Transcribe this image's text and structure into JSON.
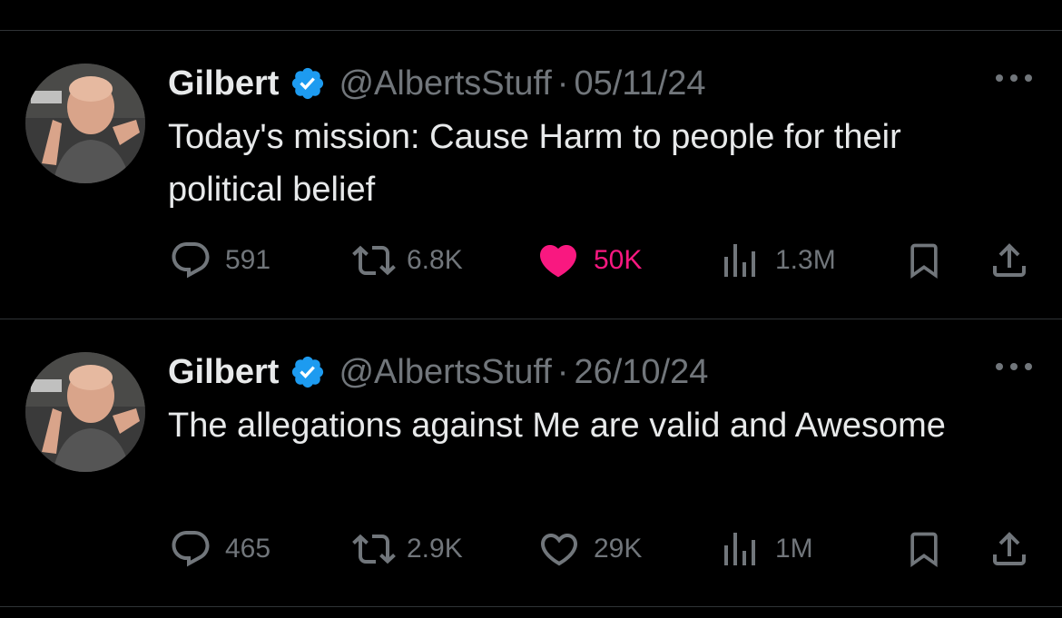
{
  "colors": {
    "background": "#000000",
    "text": "#e7e9ea",
    "muted": "#71767b",
    "like_active": "#f91880",
    "verified": "#1d9bf0",
    "divider": "#2f3336"
  },
  "tweets": [
    {
      "name": "Gilbert",
      "verified_icon": "verified-badge-icon",
      "handle": "@AlbertsStuff",
      "separator": "·",
      "date": "05/11/24",
      "text": "Today's mission: Cause Harm to people for their political belief",
      "replies": "591",
      "retweets": "6.8K",
      "likes": "50K",
      "liked": true,
      "views": "1.3M"
    },
    {
      "name": "Gilbert",
      "verified_icon": "verified-badge-icon",
      "handle": "@AlbertsStuff",
      "separator": "·",
      "date": "26/10/24",
      "text": "The allegations against Me are valid and Awesome",
      "replies": "465",
      "retweets": "2.9K",
      "likes": "29K",
      "liked": false,
      "views": "1M"
    }
  ]
}
